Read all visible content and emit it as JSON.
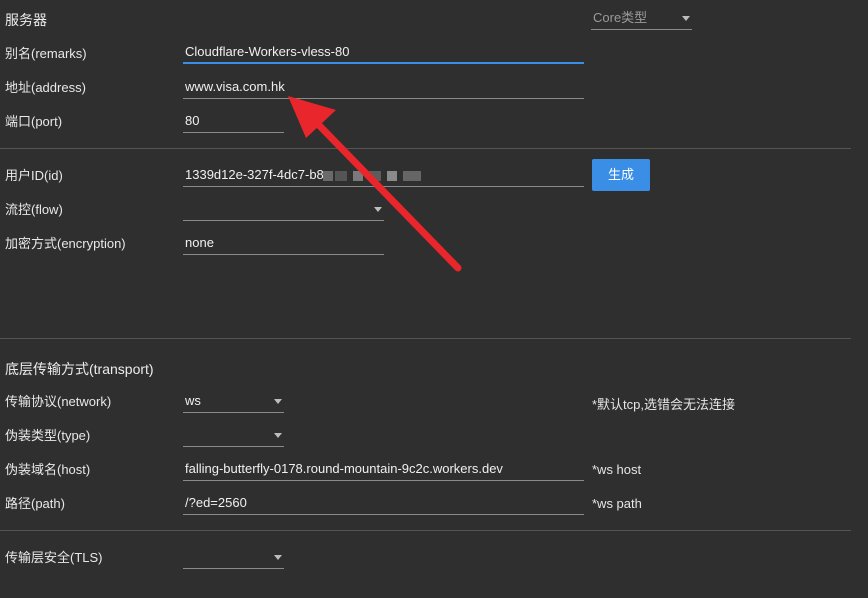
{
  "server": {
    "section_title": "服务器",
    "core_type": {
      "placeholder": "Core类型"
    },
    "remarks": {
      "label": "别名(remarks)",
      "value": "Cloudflare-Workers-vless-80"
    },
    "address": {
      "label": "地址(address)",
      "value": "www.visa.com.hk"
    },
    "port": {
      "label": "端口(port)",
      "value": "80"
    }
  },
  "user": {
    "id": {
      "label": "用户ID(id)",
      "value": "1339d12e-327f-4dc7-b8"
    },
    "generate_label": "生成",
    "flow": {
      "label": "流控(flow)",
      "value": ""
    },
    "encryption": {
      "label": "加密方式(encryption)",
      "value": "none"
    }
  },
  "transport": {
    "section_title": "底层传输方式(transport)",
    "network": {
      "label": "传输协议(network)",
      "value": "ws",
      "hint": "*默认tcp,选错会无法连接"
    },
    "type": {
      "label": "伪装类型(type)",
      "value": ""
    },
    "host": {
      "label": "伪装域名(host)",
      "value": "falling-butterfly-0178.round-mountain-9c2c.workers.dev",
      "hint": "*ws host"
    },
    "path": {
      "label": "路径(path)",
      "value": "/?ed=2560",
      "hint": "*ws path"
    }
  },
  "tls": {
    "label": "传输层安全(TLS)",
    "value": ""
  },
  "colors": {
    "accent": "#3a8ee6",
    "arrow": "#e8262b",
    "background": "#2f2f2f"
  }
}
